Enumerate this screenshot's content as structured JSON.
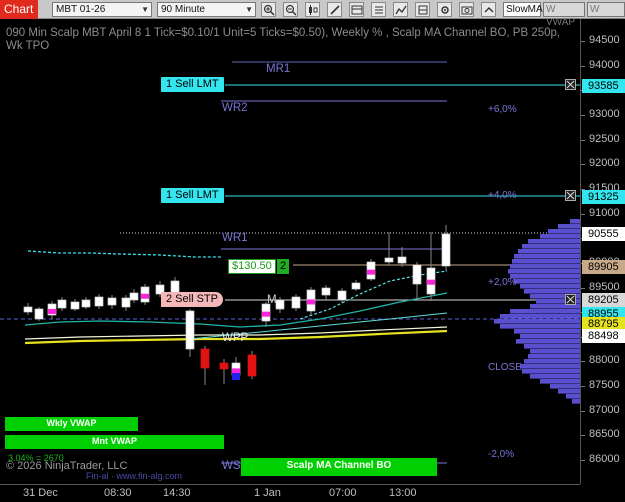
{
  "toolbar": {
    "tab_label": "Chart",
    "instrument": "MBT 01-26",
    "interval": "90 Minute",
    "toggles": [
      "SlowMA",
      "W VWAP",
      "W VALUE"
    ]
  },
  "chart": {
    "title": "090 Min Scalp MBT April 8 1 Tick=$0.10/1 Unit=5 Ticks=$0.50), Weekly % , Scalp MA Channel BO, PB 250p, Wk TPO",
    "copyright": "© 2026 NinjaTrader, LLC",
    "watermark": "Fin-al · www.fin-alg.com",
    "footer_value": "3.04% = 2670"
  },
  "price_axis": {
    "ticks": [
      "94500",
      "94000",
      "93500",
      "93000",
      "92500",
      "92000",
      "91500",
      "91000",
      "90500",
      "90000",
      "89500",
      "89000",
      "88500",
      "88000",
      "87500",
      "87000",
      "86500",
      "86000"
    ],
    "labels": {
      "p93585": "93585",
      "p91325": "91325",
      "p90555": "90555",
      "p89905": "89905",
      "p89205": "89205",
      "p88955": "88955",
      "p88795": "88795",
      "p88498": "88498"
    }
  },
  "time_axis": [
    "31 Dec",
    "08:30",
    "14:30",
    "1 Jan",
    "07:00",
    "13:00"
  ],
  "orders": {
    "sell_lmt_1": "1 Sell LMT",
    "sell_lmt_2": "1 Sell LMT",
    "sell_stp": "2 Sell STP",
    "pnl": "$130.50",
    "qty": "2"
  },
  "levels": {
    "mr1": "MR1",
    "wr2": "WR2",
    "wr1": "WR1",
    "m": "M",
    "wpp": "WPP",
    "ws1": "WS1",
    "close": "CLOSE"
  },
  "percent_labels": {
    "p6": "+6,0%",
    "p4": "+4,0%",
    "p2": "+2,0%",
    "m2": "-2,0%"
  },
  "vwap_bars": {
    "weekly": "Wkly VWAP",
    "monthly": "Mnt VWAP",
    "channel": "Scalp MA Channel BO"
  },
  "colors": {
    "background": "#000000",
    "sell_lmt": "#33e5ee",
    "sell_stp": "#f5b8b8",
    "level_purple": "#7a74d8",
    "vwap_green": "#00d000",
    "profile_purple": "#5a4fcf",
    "candle_up": "#ffffff",
    "candle_down": "#e11212"
  }
}
